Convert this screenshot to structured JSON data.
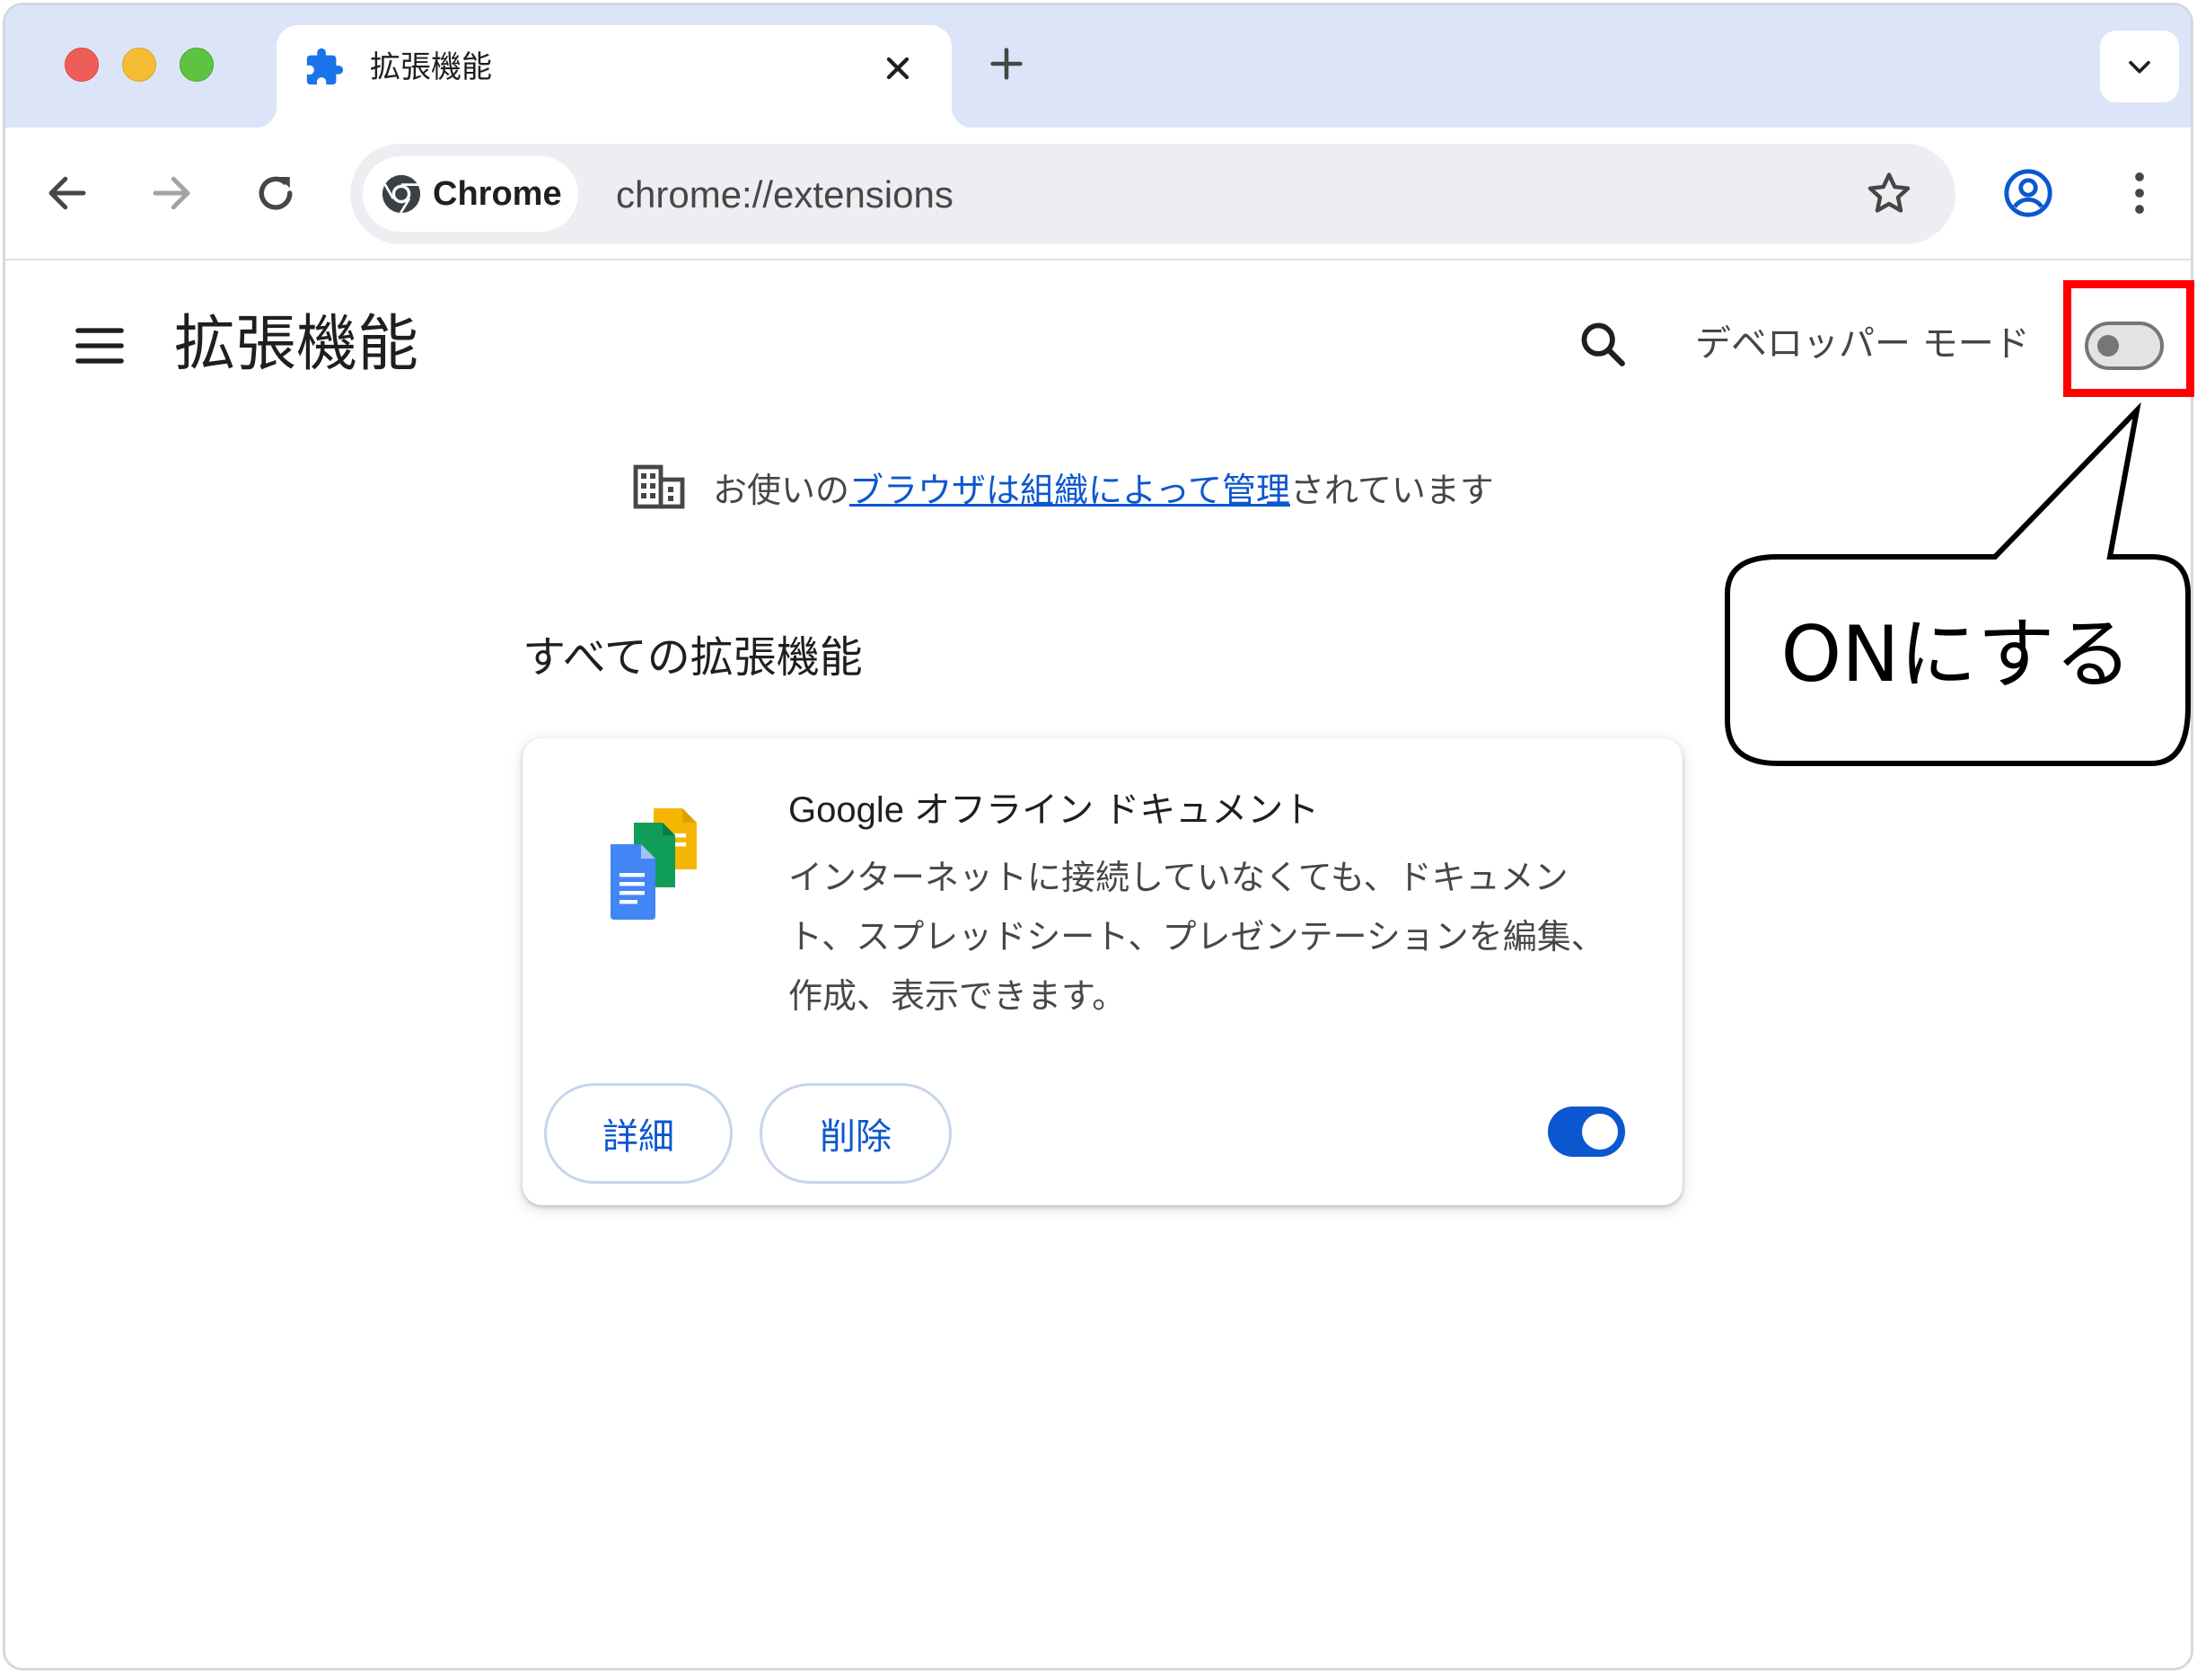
{
  "tab": {
    "title": "拡張機能"
  },
  "toolbar": {
    "chip_label": "Chrome",
    "url": "chrome://extensions"
  },
  "page": {
    "title": "拡張機能",
    "developer_mode_label": "デベロッパー モード",
    "developer_mode_on": false,
    "managed_notice": {
      "prefix": "お使いの",
      "link": "ブラウザは組織によって管理",
      "suffix": "されています"
    },
    "section_title": "すべての拡張機能"
  },
  "extension": {
    "name": "Google オフライン ドキュメント",
    "description": "インターネットに接続していなくても、ドキュメント、スプレッドシート、プレゼンテーションを編集、作成、表示できます。",
    "details_label": "詳細",
    "remove_label": "削除",
    "enabled": true
  },
  "annotation": {
    "callout_text": "ONにする",
    "highlight_color": "#ff0000"
  },
  "colors": {
    "accent": "#0b57d0",
    "tabstrip": "#dbe5f7",
    "traffic_red": "#ee5d57",
    "traffic_yellow": "#f5bd34",
    "traffic_green": "#5ec340"
  },
  "icons": {
    "tab": "puzzle-icon",
    "chip": "chrome-logo-icon",
    "managed": "building-icon",
    "extension": "google-docs-offline-icon"
  }
}
